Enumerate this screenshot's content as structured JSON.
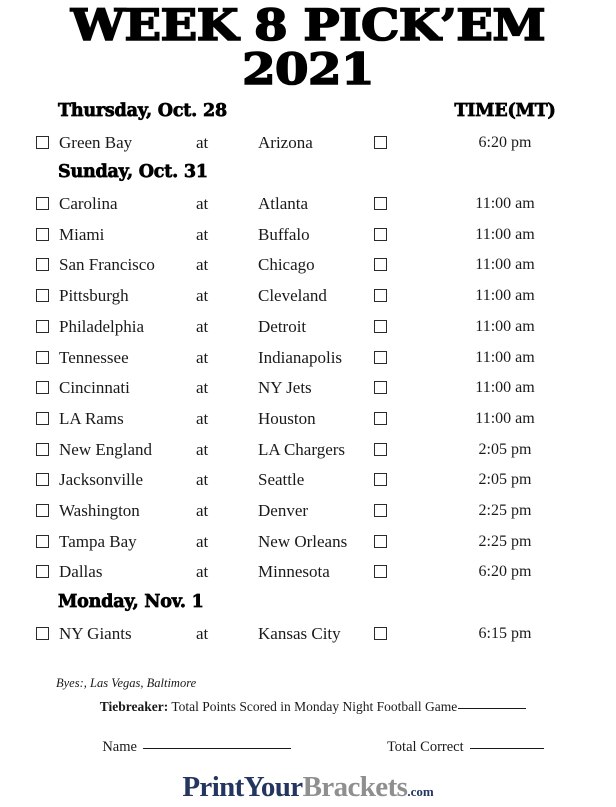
{
  "title": {
    "line1": "WEEK 8 PICK’EM",
    "line2": "2021"
  },
  "columns": {
    "time_header": "TIME(MT)",
    "at_word": "at"
  },
  "sections": [
    {
      "day_header": "Thursday, Oct. 28",
      "show_time_header": true,
      "games": [
        {
          "away": "Green Bay",
          "at": "at",
          "home": "Arizona",
          "time": "6:20 pm"
        }
      ]
    },
    {
      "day_header": "Sunday, Oct. 31",
      "show_time_header": false,
      "games": [
        {
          "away": "Carolina",
          "at": "at",
          "home": "Atlanta",
          "time": "11:00 am"
        },
        {
          "away": "Miami",
          "at": "at",
          "home": "Buffalo",
          "time": "11:00 am"
        },
        {
          "away": "San Francisco",
          "at": "at",
          "home": "Chicago",
          "time": "11:00 am"
        },
        {
          "away": "Pittsburgh",
          "at": "at",
          "home": "Cleveland",
          "time": "11:00 am"
        },
        {
          "away": "Philadelphia",
          "at": "at",
          "home": "Detroit",
          "time": "11:00 am"
        },
        {
          "away": "Tennessee",
          "at": "at",
          "home": "Indianapolis",
          "time": "11:00 am"
        },
        {
          "away": "Cincinnati",
          "at": "at",
          "home": "NY Jets",
          "time": "11:00 am"
        },
        {
          "away": "LA Rams",
          "at": "at",
          "home": "Houston",
          "time": "11:00 am"
        },
        {
          "away": "New England",
          "at": "at",
          "home": "LA Chargers",
          "time": "2:05 pm"
        },
        {
          "away": "Jacksonville",
          "at": "at",
          "home": "Seattle",
          "time": "2:05 pm"
        },
        {
          "away": "Washington",
          "at": "at",
          "home": "Denver",
          "time": "2:25 pm"
        },
        {
          "away": "Tampa Bay",
          "at": "at",
          "home": "New Orleans",
          "time": "2:25 pm"
        },
        {
          "away": "Dallas",
          "at": "at",
          "home": "Minnesota",
          "time": "6:20 pm"
        }
      ]
    },
    {
      "day_header": "Monday, Nov. 1",
      "show_time_header": false,
      "games": [
        {
          "away": "NY Giants",
          "at": "at",
          "home": "Kansas City",
          "time": "6:15 pm"
        }
      ]
    }
  ],
  "footer": {
    "byes": "Byes:, Las Vegas, Baltimore",
    "tiebreaker_label": "Tiebreaker:",
    "tiebreaker_text": "Total Points Scored in Monday Night Football Game",
    "name_label": "Name",
    "total_correct_label": "Total Correct"
  },
  "logo": {
    "part1": "PrintYour",
    "part2": "Brackets",
    "part3": ".com",
    "color_navy": "#24365f",
    "color_gray": "#8f8f8f"
  }
}
